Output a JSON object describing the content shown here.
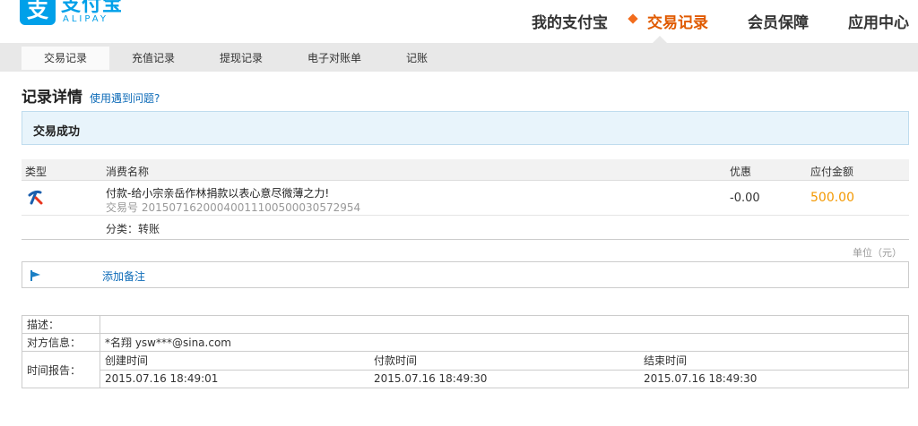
{
  "logo": {
    "glyph": "支",
    "cn": "支付宝",
    "en": "ALIPAY"
  },
  "topnav": [
    {
      "label": "我的支付宝",
      "active": false
    },
    {
      "label": "交易记录",
      "active": true
    },
    {
      "label": "会员保障",
      "active": false
    },
    {
      "label": "应用中心",
      "active": false
    }
  ],
  "subnav": [
    {
      "label": "交易记录",
      "active": true
    },
    {
      "label": "充值记录",
      "active": false
    },
    {
      "label": "提现记录",
      "active": false
    },
    {
      "label": "电子对账单",
      "active": false
    },
    {
      "label": "记账",
      "active": false
    }
  ],
  "page": {
    "title": "记录详情",
    "help_link": "使用遇到问题?"
  },
  "status": {
    "text": "交易成功"
  },
  "detail": {
    "headers": {
      "type": "类型",
      "name": "消费名称",
      "discount": "优惠",
      "amount": "应付金额"
    },
    "item_name": "付款-给小宗亲岳作林捐款以表心意尽微薄之力!",
    "trade_no": "交易号 2015071620004001110050003057295",
    "trade_no_full": "交易号 20150716200040011100500030572954",
    "discount": "-0.00",
    "amount": "500.00",
    "category": "分类：转账",
    "unit": "单位（元）"
  },
  "memo": {
    "label": "添加备注"
  },
  "info": {
    "desc_label": "描述：",
    "desc_value": "",
    "party_label": "对方信息：",
    "party_value": "*名翔 ysw***@sina.com",
    "time_label": "时间报告：",
    "time_headers": [
      "创建时间",
      "付款时间",
      "结束时间"
    ],
    "time_values": [
      "2015.07.16 18:49:01",
      "2015.07.16 18:49:30",
      "2015.07.16 18:49:30"
    ]
  },
  "colors": {
    "brand": "#00a0e9",
    "accent": "#e05a00",
    "amount": "#f39800",
    "link": "#0d6bb8"
  }
}
